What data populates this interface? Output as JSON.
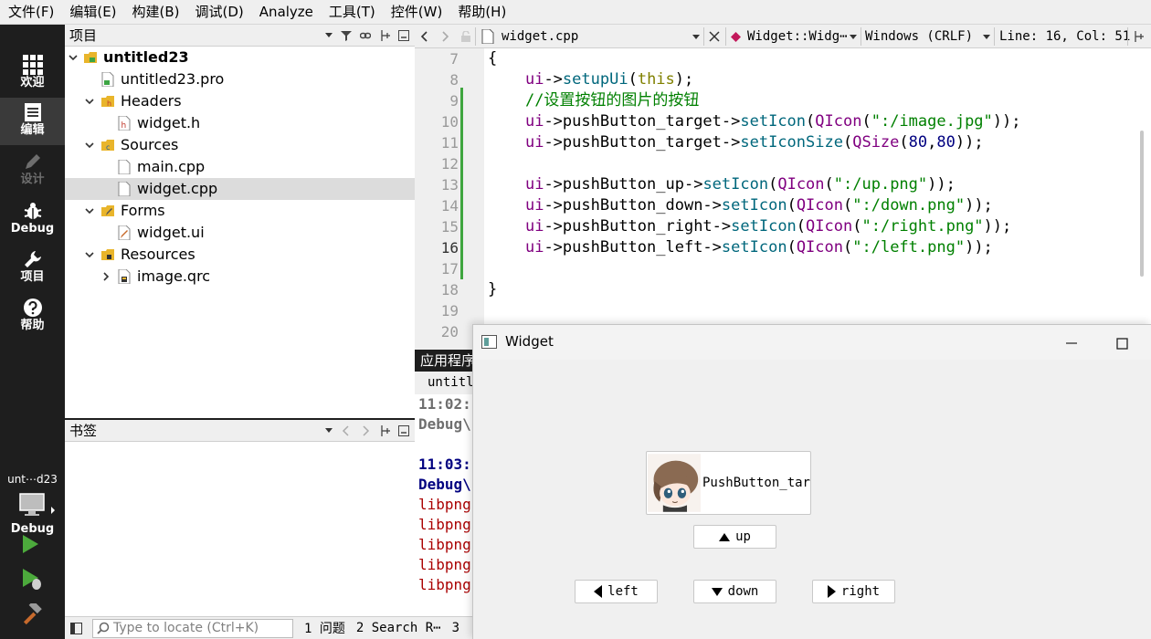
{
  "menubar": {
    "items": [
      "文件(F)",
      "编辑(E)",
      "构建(B)",
      "调试(D)",
      "Analyze",
      "工具(T)",
      "控件(W)",
      "帮助(H)"
    ]
  },
  "modebar": {
    "welcome": "欢迎",
    "edit": "编辑",
    "design": "设计",
    "debug": "Debug",
    "project": "项目",
    "help": "帮助",
    "kit_name": "unt⋯d23",
    "kit_label": "Debug"
  },
  "project_pane": {
    "title": "项目",
    "tree": [
      {
        "label": "untitled23",
        "icon": "project-folder-icon"
      },
      {
        "label": "untitled23.pro",
        "icon": "pro-file-icon"
      },
      {
        "label": "Headers",
        "icon": "headers-folder-icon"
      },
      {
        "label": "widget.h",
        "icon": "header-file-icon"
      },
      {
        "label": "Sources",
        "icon": "sources-folder-icon"
      },
      {
        "label": "main.cpp",
        "icon": "cpp-file-icon"
      },
      {
        "label": "widget.cpp",
        "icon": "cpp-file-icon"
      },
      {
        "label": "Forms",
        "icon": "forms-folder-icon"
      },
      {
        "label": "widget.ui",
        "icon": "ui-file-icon"
      },
      {
        "label": "Resources",
        "icon": "resources-folder-icon"
      },
      {
        "label": "image.qrc",
        "icon": "qrc-file-icon"
      }
    ]
  },
  "bookmarks_pane": {
    "title": "书签"
  },
  "statusbar": {
    "locator_placeholder": "Type to locate (Ctrl+K)",
    "tab1": "1 问题",
    "tab2": "2 Search R⋯",
    "tab3": "3"
  },
  "editor_toolbar": {
    "file": "widget.cpp",
    "symbol": "Widget::Widg⋯",
    "line_ending": "Windows (CRLF)",
    "position": "Line: 16, Col: 51"
  },
  "editor": {
    "line_numbers": [
      "7",
      "8",
      "9",
      "10",
      "11",
      "12",
      "13",
      "14",
      "15",
      "16",
      "17",
      "18",
      "19",
      "20"
    ],
    "code": [
      "{",
      "    ui->setupUi(this);",
      "    //设置按钮的图片的按钮",
      "    ui->pushButton_target->setIcon(QIcon(\":/image.jpg\"));",
      "    ui->pushButton_target->setIconSize(QSize(80,80));",
      "",
      "    ui->pushButton_up->setIcon(QIcon(\":/up.png\"));",
      "    ui->pushButton_down->setIcon(QIcon(\":/down.png\"));",
      "    ui->pushButton_right->setIcon(QIcon(\":/right.png\"));",
      "    ui->pushButton_left->setIcon(QIcon(\":/left.png\"));",
      "",
      "}",
      "",
      ""
    ]
  },
  "output_pane": {
    "title": "应用程序",
    "tab": "untitle",
    "lines": [
      "11:02:",
      "Debug\\",
      "",
      "11:03:",
      "Debug\\",
      "libpng",
      "libpng",
      "libpng",
      "libpng",
      "libpng"
    ]
  },
  "widget_window": {
    "title": "Widget",
    "target_label": "PushButton_tar",
    "up_label": "up",
    "down_label": "down",
    "left_label": "left",
    "right_label": "right"
  }
}
